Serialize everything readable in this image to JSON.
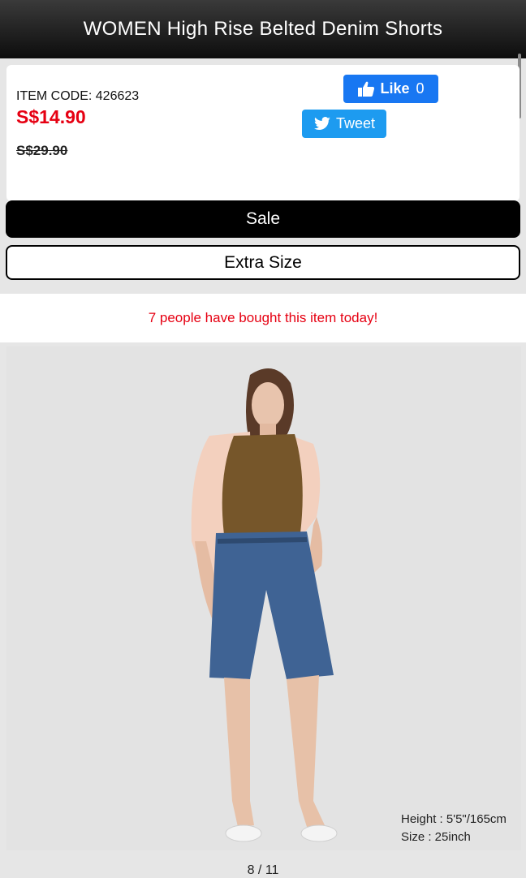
{
  "header": {
    "title": "WOMEN High Rise Belted Denim Shorts"
  },
  "product": {
    "item_code": "ITEM CODE: 426623",
    "price": "S$14.90",
    "original_price": "S$29.90"
  },
  "social": {
    "like_label": "Like",
    "like_count": "0",
    "tweet_label": "Tweet",
    "like_color": "#1877f2",
    "tweet_color": "#1d9bf0"
  },
  "tags": {
    "sale_label": "Sale",
    "extra_size_label": "Extra Size"
  },
  "promo": {
    "text": "7 people have bought this item today!"
  },
  "image": {
    "caption_height": "Height : 5'5\"/165cm",
    "caption_size": "Size : 25inch"
  },
  "pager": {
    "text": "8 / 11"
  },
  "icons": [
    "thumbs-up-icon",
    "twitter-bird-icon"
  ],
  "colors": {
    "accent_red": "#e60012",
    "header_bg": "#111111"
  }
}
